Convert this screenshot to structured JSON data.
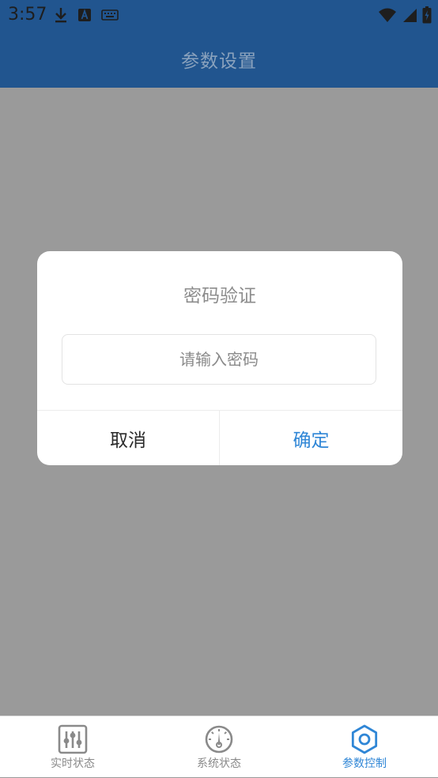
{
  "status_bar": {
    "time": "3:57",
    "left_icons": [
      "download-icon",
      "a-badge-icon",
      "keyboard-icon"
    ],
    "right_icons": [
      "wifi-icon",
      "cellular-signal-icon",
      "battery-charging-icon"
    ]
  },
  "app_bar": {
    "title": "参数设置",
    "background": "#21558f"
  },
  "dialog": {
    "title": "密码验证",
    "password_input": {
      "value": "",
      "placeholder": "请输入密码"
    },
    "cancel_label": "取消",
    "confirm_label": "确定",
    "confirm_color": "#2f86d6"
  },
  "tab_bar": {
    "tabs": [
      {
        "label": "实时状态",
        "icon": "sliders-icon",
        "active": false
      },
      {
        "label": "系统状态",
        "icon": "gauge-icon",
        "active": false
      },
      {
        "label": "参数控制",
        "icon": "gear-icon",
        "active": true
      }
    ]
  }
}
